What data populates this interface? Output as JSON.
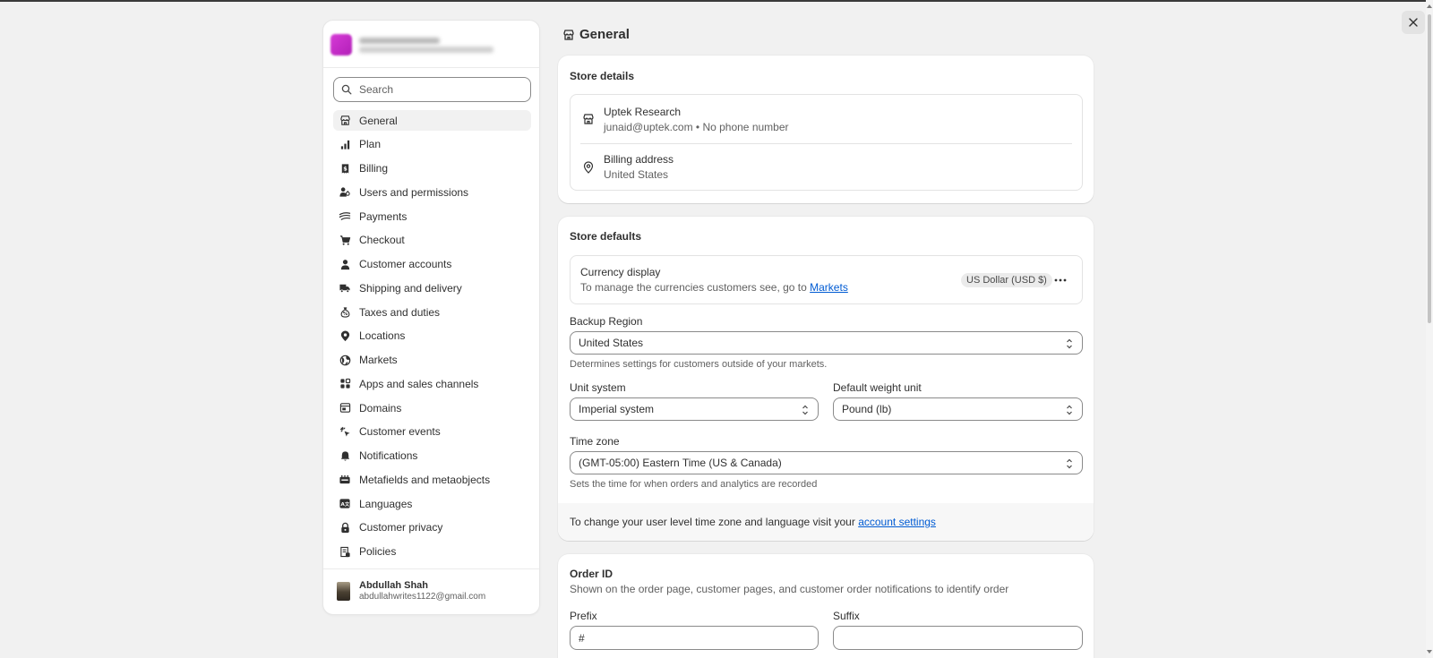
{
  "window": {
    "close_icon": "close-icon"
  },
  "sidebar": {
    "search": {
      "placeholder": "Search"
    },
    "items": [
      {
        "label": "General",
        "icon": "store-icon",
        "active": true
      },
      {
        "label": "Plan",
        "icon": "plan-icon"
      },
      {
        "label": "Billing",
        "icon": "billing-icon"
      },
      {
        "label": "Users and permissions",
        "icon": "users-icon"
      },
      {
        "label": "Payments",
        "icon": "payments-icon"
      },
      {
        "label": "Checkout",
        "icon": "cart-icon"
      },
      {
        "label": "Customer accounts",
        "icon": "person-icon"
      },
      {
        "label": "Shipping and delivery",
        "icon": "truck-icon"
      },
      {
        "label": "Taxes and duties",
        "icon": "tax-icon"
      },
      {
        "label": "Locations",
        "icon": "location-icon"
      },
      {
        "label": "Markets",
        "icon": "globe-icon"
      },
      {
        "label": "Apps and sales channels",
        "icon": "apps-icon"
      },
      {
        "label": "Domains",
        "icon": "domain-icon"
      },
      {
        "label": "Customer events",
        "icon": "cursor-icon"
      },
      {
        "label": "Notifications",
        "icon": "bell-icon"
      },
      {
        "label": "Metafields and metaobjects",
        "icon": "metafields-icon"
      },
      {
        "label": "Languages",
        "icon": "language-icon"
      },
      {
        "label": "Customer privacy",
        "icon": "lock-icon"
      },
      {
        "label": "Policies",
        "icon": "policy-icon"
      }
    ],
    "user": {
      "name": "Abdullah Shah",
      "email": "abdullahwrites1122@gmail.com"
    }
  },
  "page": {
    "title": "General"
  },
  "store_details": {
    "title": "Store details",
    "store_name": "Uptek Research",
    "store_contact": "junaid@uptek.com • No phone number",
    "billing_label": "Billing address",
    "billing_value": "United States"
  },
  "store_defaults": {
    "title": "Store defaults",
    "currency": {
      "label": "Currency display",
      "description": "To manage the currencies customers see, go to",
      "link": "Markets",
      "badge": "US Dollar (USD $)"
    },
    "backup_region": {
      "label": "Backup Region",
      "value": "United States",
      "help": "Determines settings for customers outside of your markets."
    },
    "unit_system": {
      "label": "Unit system",
      "value": "Imperial system"
    },
    "weight_unit": {
      "label": "Default weight unit",
      "value": "Pound (lb)"
    },
    "time_zone": {
      "label": "Time zone",
      "value": "(GMT-05:00) Eastern Time (US & Canada)",
      "help": "Sets the time for when orders and analytics are recorded"
    },
    "footer": {
      "text": "To change your user level time zone and language visit your",
      "link": "account settings"
    }
  },
  "order_id": {
    "title": "Order ID",
    "description": "Shown on the order page, customer pages, and customer order notifications to identify order",
    "prefix_label": "Prefix",
    "prefix_value": "#",
    "suffix_label": "Suffix",
    "suffix_value": ""
  }
}
